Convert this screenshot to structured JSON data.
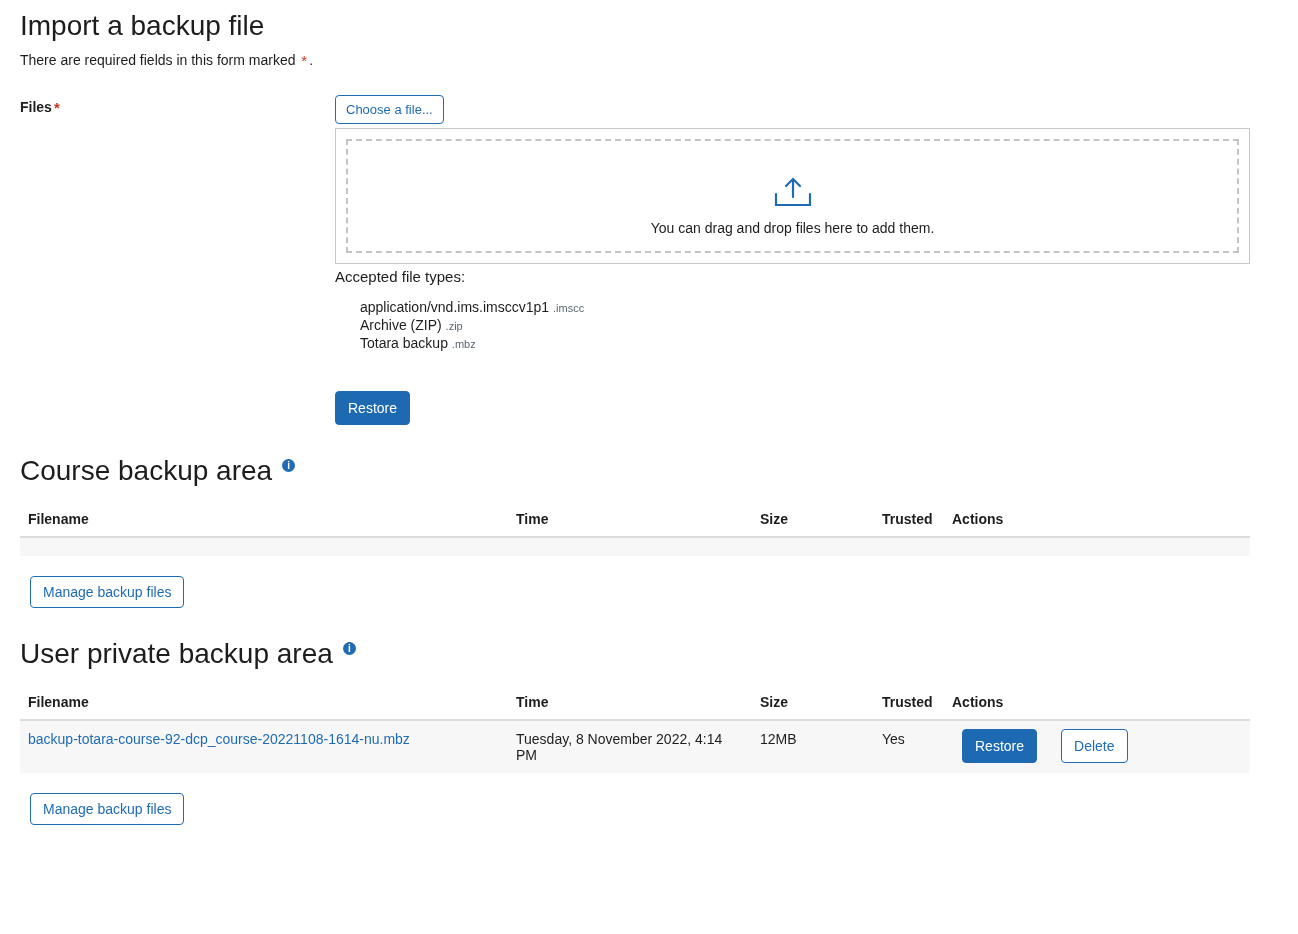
{
  "title": "Import a backup file",
  "required_note": {
    "text": "There are required fields in this form marked",
    "marker": "*",
    "end": "."
  },
  "files_field": {
    "label": "Files",
    "marker": "*",
    "choose_button": "Choose a file...",
    "drop_hint": "You can drag and drop files here to add them.",
    "accepted_label": "Accepted file types:",
    "file_types": [
      {
        "name": "application/vnd.ims.imsccv1p1",
        "ext": ".imscc"
      },
      {
        "name": "Archive (ZIP)",
        "ext": ".zip"
      },
      {
        "name": "Totara backup",
        "ext": ".mbz"
      }
    ]
  },
  "restore_button": "Restore",
  "areas": [
    {
      "title": "Course backup area",
      "info": "i",
      "columns": [
        "Filename",
        "Time",
        "Size",
        "Trusted",
        "Actions"
      ],
      "manage_button": "Manage backup files"
    },
    {
      "title": "User private backup area",
      "info": "i",
      "columns": [
        "Filename",
        "Time",
        "Size",
        "Trusted",
        "Actions"
      ],
      "rows": [
        {
          "filename": "backup-totara-course-92-dcp_course-20221108-1614-nu.mbz",
          "time": "Tuesday, 8 November 2022, 4:14 PM",
          "size": "12MB",
          "trusted": "Yes",
          "actions": [
            {
              "kind": "primary",
              "label": "Restore"
            },
            {
              "kind": "secondary",
              "label": "Delete"
            }
          ]
        }
      ],
      "manage_button": "Manage backup files"
    }
  ]
}
